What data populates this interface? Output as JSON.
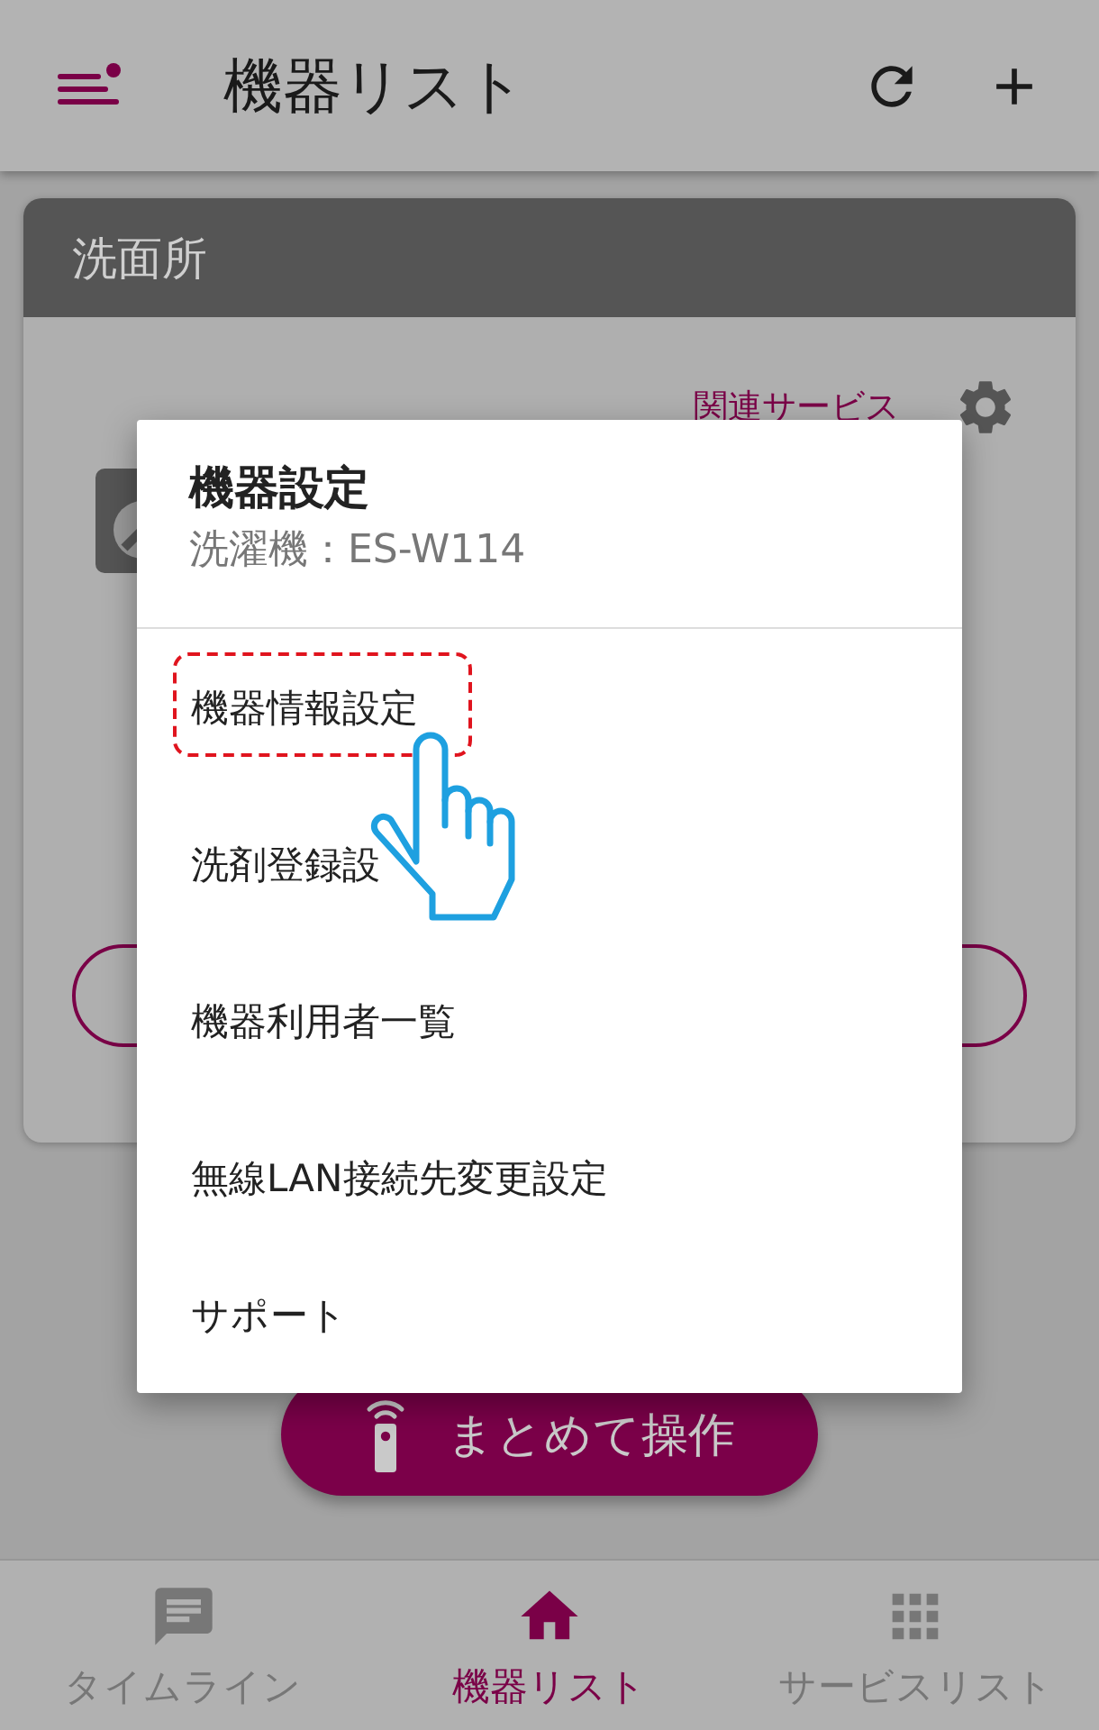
{
  "header": {
    "title": "機器リスト"
  },
  "room_card": {
    "title": "洗面所",
    "related_link": "関連サービス"
  },
  "dialog": {
    "title": "機器設定",
    "subtitle": "洗濯機：ES-W114",
    "items": [
      {
        "label": "機器情報設定",
        "highlighted": true
      },
      {
        "label": "洗剤登録設",
        "highlighted": false
      },
      {
        "label": "機器利用者一覧",
        "highlighted": false
      },
      {
        "label": "無線LAN接続先変更設定",
        "highlighted": false
      },
      {
        "label": "サポート",
        "highlighted": false
      }
    ]
  },
  "bulk_button": {
    "label": "まとめて操作"
  },
  "bottom_nav": [
    {
      "label": "タイムライン",
      "kind": "timeline",
      "selected": false
    },
    {
      "label": "機器リスト",
      "kind": "home",
      "selected": true
    },
    {
      "label": "サービスリスト",
      "kind": "services",
      "selected": false
    }
  ]
}
